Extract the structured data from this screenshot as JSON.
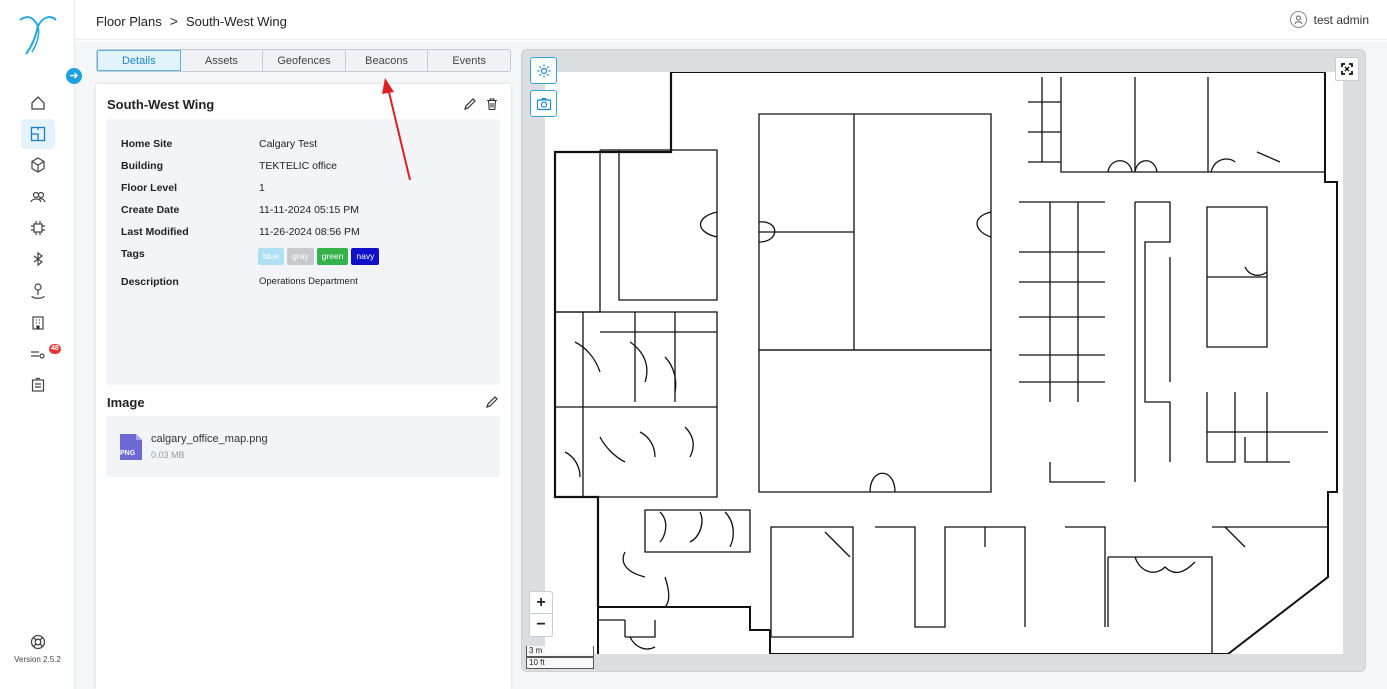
{
  "breadcrumb": {
    "parent": "Floor Plans",
    "separator": ">",
    "current": "South-West Wing"
  },
  "user": {
    "name": "test admin"
  },
  "sidebar": {
    "items": [
      {
        "icon": "home-icon"
      },
      {
        "icon": "floor-plan-icon",
        "active": true
      },
      {
        "icon": "cube-icon"
      },
      {
        "icon": "users-icon"
      },
      {
        "icon": "chip-icon"
      },
      {
        "icon": "bluetooth-icon"
      },
      {
        "icon": "location-pin-icon"
      },
      {
        "icon": "building-icon"
      },
      {
        "icon": "alerts-icon",
        "badge": "48"
      },
      {
        "icon": "reports-icon"
      }
    ],
    "version": "Version 2.5.2"
  },
  "tabs": [
    "Details",
    "Assets",
    "Geofences",
    "Beacons",
    "Events"
  ],
  "details": {
    "title": "South-West Wing",
    "rows": [
      {
        "label": "Home Site",
        "value": "Calgary Test"
      },
      {
        "label": "Building",
        "value": "TEKTELIC office"
      },
      {
        "label": "Floor Level",
        "value": "1"
      },
      {
        "label": "Create Date",
        "value": "11-11-2024 05:15 PM"
      },
      {
        "label": "Last Modified",
        "value": "11-26-2024 08:56 PM"
      },
      {
        "label": "Tags",
        "value": ""
      },
      {
        "label": "Description",
        "value": "Operations Department"
      }
    ],
    "tags": [
      {
        "name": "blue",
        "color": "#aee0f3"
      },
      {
        "name": "gray",
        "color": "#c7c9cc"
      },
      {
        "name": "green",
        "color": "#35b24a"
      },
      {
        "name": "navy",
        "color": "#1010c8"
      }
    ]
  },
  "image": {
    "title": "Image",
    "file_type": "PNG",
    "file_name": "calgary_office_map.png",
    "file_size": "0.03 MB"
  },
  "map": {
    "zoom_in": "+",
    "zoom_out": "−",
    "scale_metric": "3 m",
    "scale_imperial": "10 ft"
  },
  "colors": {
    "accent": "#1b87c9",
    "annotation_arrow": "#e02020",
    "file_icon": "#6d6ad6"
  }
}
